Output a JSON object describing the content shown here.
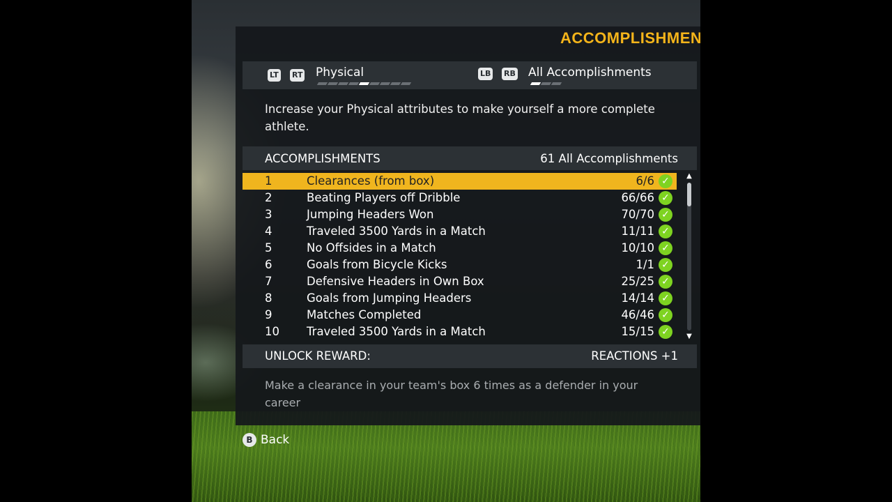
{
  "header": {
    "title": "ACCOMPLISHMENT"
  },
  "tabs": {
    "left": {
      "prev_button": "LT",
      "next_button": "RT",
      "label": "Physical",
      "page_count": 9,
      "active_index": 4
    },
    "right": {
      "prev_button": "LB",
      "next_button": "RB",
      "label": "All Accomplishments",
      "page_count": 3,
      "active_index": 0
    }
  },
  "description": "Increase your Physical attributes to make yourself a more complete athlete.",
  "list": {
    "header_label": "ACCOMPLISHMENTS",
    "header_count": "61 All Accomplishments",
    "selected_index": 0,
    "items": [
      {
        "num": "1",
        "name": "Clearances (from box)",
        "progress": "6/6",
        "complete": true
      },
      {
        "num": "2",
        "name": "Beating Players off Dribble",
        "progress": "66/66",
        "complete": true
      },
      {
        "num": "3",
        "name": "Jumping Headers Won",
        "progress": "70/70",
        "complete": true
      },
      {
        "num": "4",
        "name": "Traveled 3500 Yards in a Match",
        "progress": "11/11",
        "complete": true
      },
      {
        "num": "5",
        "name": "No Offsides in a Match",
        "progress": "10/10",
        "complete": true
      },
      {
        "num": "6",
        "name": "Goals from Bicycle Kicks",
        "progress": "1/1",
        "complete": true
      },
      {
        "num": "7",
        "name": "Defensive Headers in Own Box",
        "progress": "25/25",
        "complete": true
      },
      {
        "num": "8",
        "name": "Goals from Jumping Headers",
        "progress": "14/14",
        "complete": true
      },
      {
        "num": "9",
        "name": "Matches Completed",
        "progress": "46/46",
        "complete": true
      },
      {
        "num": "10",
        "name": "Traveled 3500 Yards in a Match",
        "progress": "15/15",
        "complete": true
      }
    ]
  },
  "reward": {
    "label": "UNLOCK REWARD:",
    "value": "REACTIONS +1",
    "description": "Make a clearance in your team's box 6 times as a defender in your career"
  },
  "footer": {
    "back_button": "B",
    "back_label": "Back"
  },
  "colors": {
    "accent": "#f0b51e",
    "title": "#f4b41a",
    "check": "#7ed321",
    "panel": "#14181b"
  },
  "icons": {
    "check": "check-circle-icon",
    "scroll_up": "arrow-up-icon",
    "scroll_down": "arrow-down-icon"
  }
}
